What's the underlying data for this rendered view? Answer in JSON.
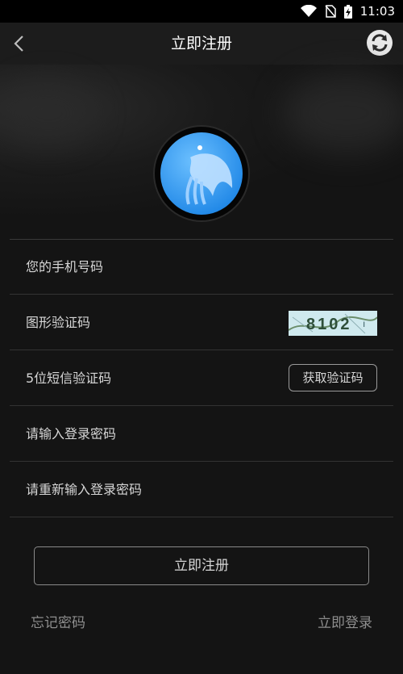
{
  "status": {
    "time": "11:03"
  },
  "appbar": {
    "title": "立即注册"
  },
  "form": {
    "phone_label": "您的手机号码",
    "captcha_label": "图形验证码",
    "captcha_text": "8102",
    "sms_label": "5位短信验证码",
    "sms_button": "获取验证码",
    "password_label": "请输入登录密码",
    "password_confirm_label": "请重新输入登录密码"
  },
  "actions": {
    "register_button": "立即注册",
    "forgot_password": "忘记密码",
    "login_now": "立即登录"
  },
  "colors": {
    "background": "#141414",
    "logo_blue": "#3aa0ef"
  }
}
